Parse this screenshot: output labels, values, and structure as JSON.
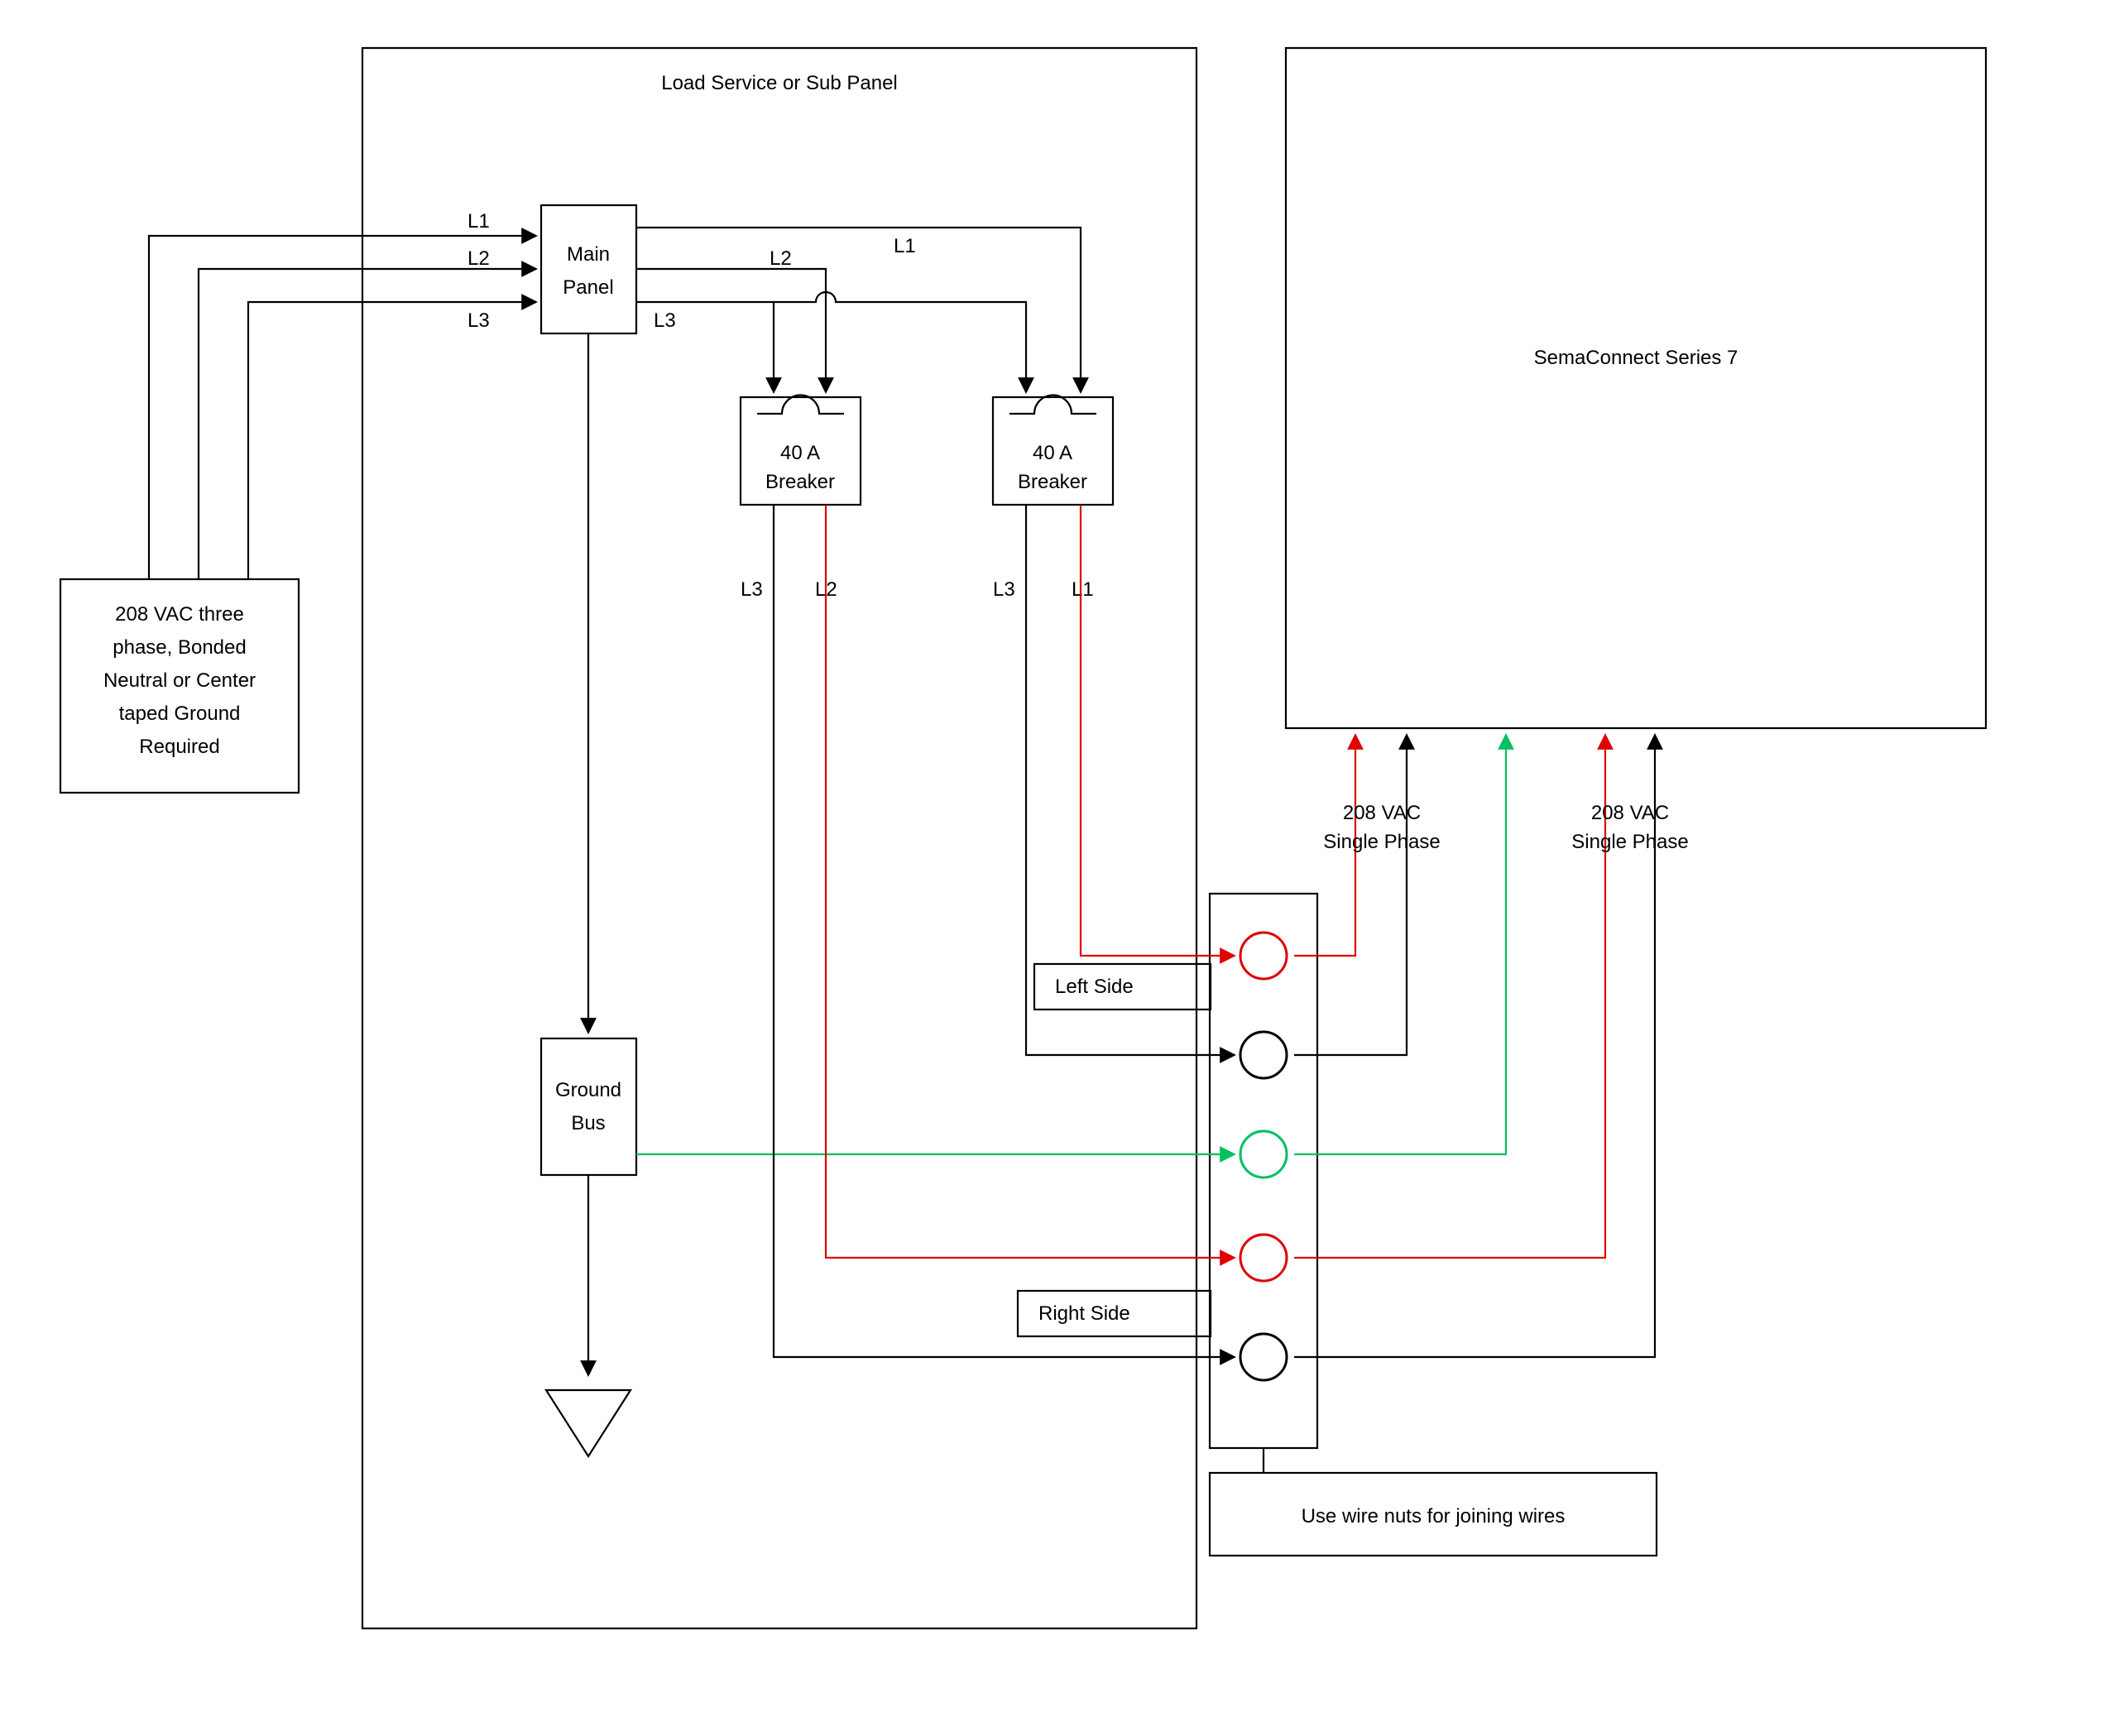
{
  "blocks": {
    "source": {
      "line1": "208 VAC three",
      "line2": "phase, Bonded",
      "line3": "Neutral or Center",
      "line4": "taped Ground",
      "line5": "Required"
    },
    "loadPanel": {
      "title": "Load Service or Sub Panel"
    },
    "mainPanel": {
      "line1": "Main",
      "line2": "Panel"
    },
    "breaker1": {
      "line1": "40 A",
      "line2": "Breaker"
    },
    "breaker2": {
      "line1": "40 A",
      "line2": "Breaker"
    },
    "groundBus": {
      "line1": "Ground",
      "line2": "Bus"
    },
    "sema": {
      "title": "SemaConnect Series 7"
    },
    "wireNuts": {
      "text": "Use wire nuts for joining wires"
    }
  },
  "labels": {
    "phase1a": "L1",
    "phase2a": "L2",
    "phase3a": "L3",
    "phase1b": "L1",
    "phase2b": "L2",
    "phase3b": "L3",
    "br1_left": "L3",
    "br1_right": "L2",
    "br2_left": "L3",
    "br2_right": "L1",
    "leftSide": "Left Side",
    "rightSide": "Right Side",
    "vac1": {
      "line1": "208 VAC",
      "line2": "Single Phase"
    },
    "vac2": {
      "line1": "208 VAC",
      "line2": "Single Phase"
    }
  },
  "colors": {
    "red": "#e00000",
    "green": "#00c060",
    "black": "#000000"
  }
}
